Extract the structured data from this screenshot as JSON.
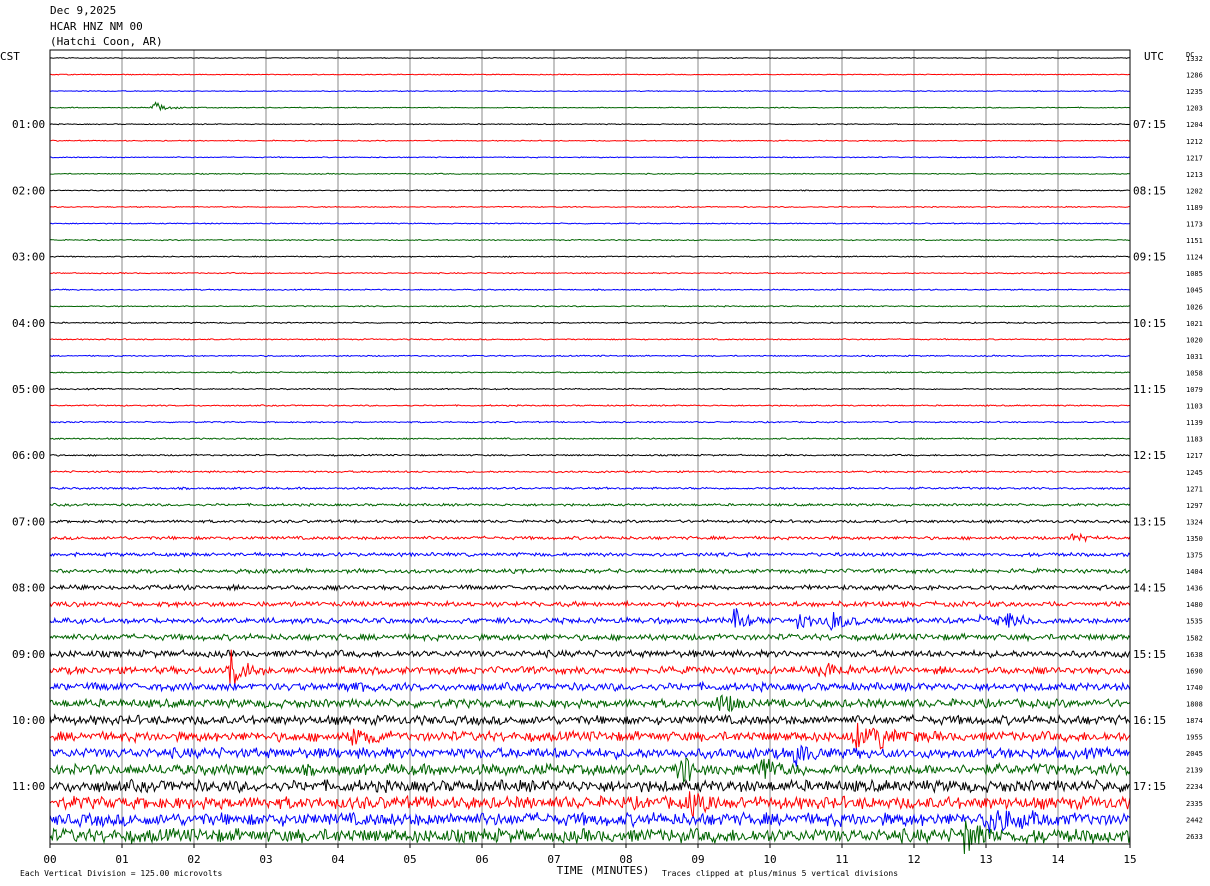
{
  "header": {
    "date": "Dec 9,2025",
    "station": "HCAR HNZ NM 00",
    "location": "(Hatchi Coon, AR)"
  },
  "chart_data": {
    "type": "line",
    "title": "Dec 9,2025",
    "left_axis_label": "CST",
    "right_axis_label": "UTC",
    "dc_label": "DC",
    "xlabel": "TIME (MINUTES)",
    "xlim": [
      0,
      15
    ],
    "x_tick_labels": [
      "00",
      "01",
      "02",
      "03",
      "04",
      "05",
      "06",
      "07",
      "08",
      "09",
      "10",
      "11",
      "12",
      "13",
      "14",
      "15"
    ],
    "left_time_labels": [
      "01:00",
      "02:00",
      "03:00",
      "04:00",
      "05:00",
      "06:00",
      "07:00",
      "08:00",
      "09:00",
      "10:00",
      "11:00"
    ],
    "right_time_labels": [
      "07:15",
      "08:15",
      "09:15",
      "10:15",
      "11:15",
      "12:15",
      "13:15",
      "14:15",
      "15:15",
      "16:15",
      "17:15"
    ],
    "hour_label_rows": [
      4,
      8,
      12,
      16,
      20,
      24,
      28,
      32,
      36,
      40,
      44
    ],
    "dc_values": [
      1332,
      1286,
      1235,
      1203,
      1204,
      1212,
      1217,
      1213,
      1202,
      1189,
      1173,
      1151,
      1124,
      1085,
      1045,
      1026,
      1021,
      1020,
      1031,
      1058,
      1079,
      1103,
      1139,
      1183,
      1217,
      1245,
      1271,
      1297,
      1324,
      1350,
      1375,
      1404,
      1436,
      1480,
      1535,
      1582,
      1638,
      1690,
      1740,
      1808,
      1874,
      1955,
      2045,
      2139,
      2234,
      2335,
      2442,
      2633
    ],
    "trace_colors": [
      "#000000",
      "#ff0000",
      "#0000ff",
      "#006400"
    ],
    "grid": true,
    "footer_left": "Each Vertical Division =  125.00 microvolts",
    "footer_right": "Traces clipped at plus/minus 5 vertical divisions",
    "events": [
      {
        "row": 3,
        "minute": 1.45,
        "amp": 6
      },
      {
        "row": 29,
        "minute": 14.2,
        "amp": 5
      },
      {
        "row": 34,
        "minute": 9.5,
        "amp": 14
      },
      {
        "row": 34,
        "minute": 10.4,
        "amp": 12
      },
      {
        "row": 34,
        "minute": 10.85,
        "amp": 14
      },
      {
        "row": 34,
        "minute": 12.95,
        "amp": 10
      },
      {
        "row": 34,
        "minute": 13.3,
        "amp": 12
      },
      {
        "row": 37,
        "minute": 2.5,
        "amp": 25
      },
      {
        "row": 37,
        "minute": 10.7,
        "amp": 16
      },
      {
        "row": 38,
        "minute": 4.1,
        "amp": 8
      },
      {
        "row": 39,
        "minute": 9.3,
        "amp": 12
      },
      {
        "row": 41,
        "minute": 4.2,
        "amp": 12
      },
      {
        "row": 41,
        "minute": 11.2,
        "amp": 14
      },
      {
        "row": 41,
        "minute": 11.55,
        "amp": 12
      },
      {
        "row": 42,
        "minute": 10.35,
        "amp": 14
      },
      {
        "row": 43,
        "minute": 8.75,
        "amp": 20
      },
      {
        "row": 43,
        "minute": 9.9,
        "amp": 14
      },
      {
        "row": 45,
        "minute": 8.9,
        "amp": 14
      },
      {
        "row": 46,
        "minute": 13.05,
        "amp": 22
      },
      {
        "row": 46,
        "minute": 13.45,
        "amp": 16
      },
      {
        "row": 47,
        "minute": 12.7,
        "amp": 22
      }
    ]
  }
}
